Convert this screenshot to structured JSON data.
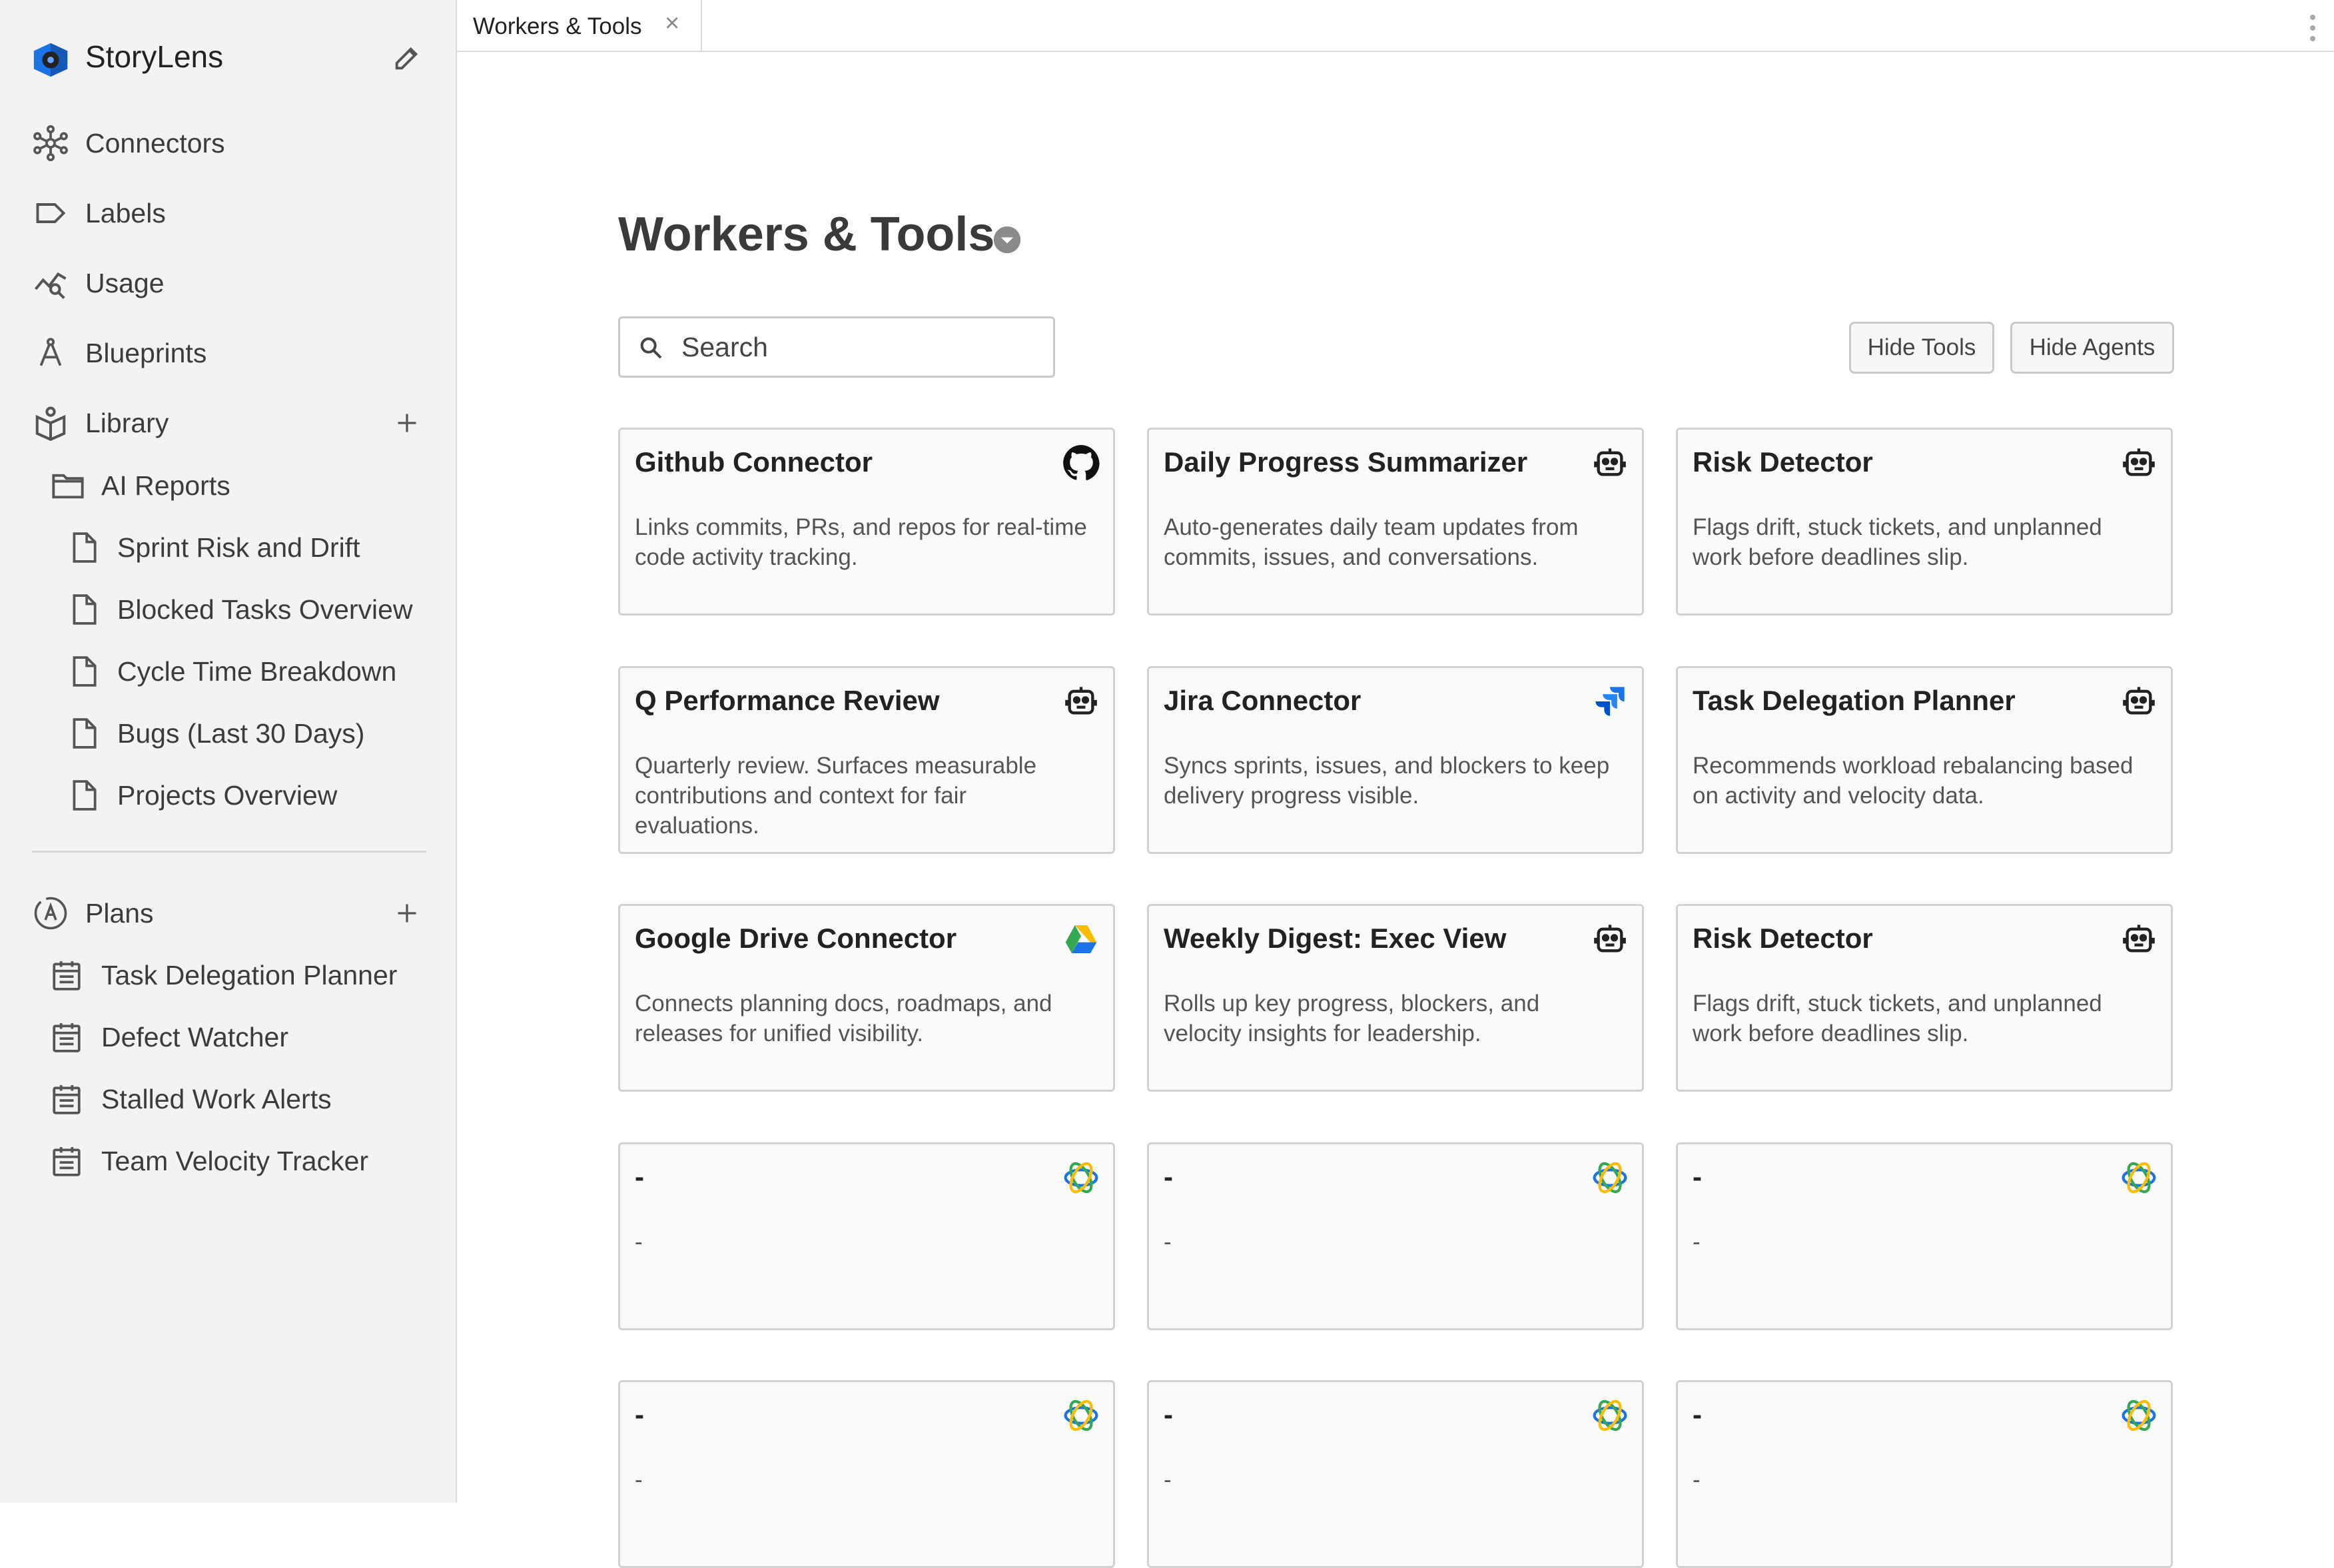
{
  "sidebar": {
    "brand": "StoryLens",
    "nav": [
      {
        "label": "Connectors",
        "icon": "hub-icon"
      },
      {
        "label": "Labels",
        "icon": "label-icon"
      },
      {
        "label": "Usage",
        "icon": "usage-chart-icon"
      },
      {
        "label": "Blueprints",
        "icon": "compass-icon"
      },
      {
        "label": "Library",
        "icon": "library-icon"
      }
    ],
    "library": {
      "folder": "AI Reports",
      "reports": [
        "Sprint Risk and Drift",
        "Blocked Tasks Overview",
        "Cycle Time Breakdown",
        "Bugs (Last 30 Days)",
        "Projects Overview"
      ]
    },
    "plans": {
      "label": "Plans",
      "items": [
        "Task Delegation Planner",
        "Defect Watcher",
        "Stalled Work Alerts",
        "Team Velocity Tracker"
      ]
    }
  },
  "tab": {
    "label": "Workers & Tools",
    "close": "×"
  },
  "main": {
    "title": "Workers & Tools",
    "search_placeholder": "Search",
    "hide_tools": "Hide Tools",
    "hide_agents": "Hide Agents",
    "cards": [
      {
        "title": "Github Connector",
        "desc": "Links commits, PRs, and repos for real-time code activity tracking.",
        "icon": "github-icon"
      },
      {
        "title": "Daily Progress Summarizer",
        "desc": "Auto-generates daily team updates from commits, issues, and conversations.",
        "icon": "robot-icon"
      },
      {
        "title": "Risk Detector",
        "desc": "Flags drift, stuck tickets, and unplanned work before deadlines slip.",
        "icon": "robot-icon"
      },
      {
        "title": "Q Performance Review",
        "desc": "Quarterly review. Surfaces measurable contributions and context for fair evaluations.",
        "icon": "robot-icon"
      },
      {
        "title": "Jira Connector",
        "desc": "Syncs sprints, issues, and blockers to keep delivery progress visible.",
        "icon": "jira-icon"
      },
      {
        "title": "Task Delegation Planner",
        "desc": "Recommends workload rebalancing based on activity and velocity data.",
        "icon": "robot-icon"
      },
      {
        "title": "Google Drive Connector",
        "desc": "Connects planning docs, roadmaps, and releases for unified visibility.",
        "icon": "google-drive-icon"
      },
      {
        "title": "Weekly Digest: Exec View",
        "desc": "Rolls up key progress, blockers, and velocity insights for leadership.",
        "icon": "robot-icon"
      },
      {
        "title": "Risk Detector",
        "desc": "Flags drift, stuck tickets, and unplanned work before deadlines slip.",
        "icon": "robot-icon"
      },
      {
        "title": "-",
        "desc": "-",
        "icon": "orbit-icon"
      },
      {
        "title": "-",
        "desc": "-",
        "icon": "orbit-icon"
      },
      {
        "title": "-",
        "desc": "-",
        "icon": "orbit-icon"
      },
      {
        "title": "-",
        "desc": "-",
        "icon": "orbit-icon"
      },
      {
        "title": "-",
        "desc": "-",
        "icon": "orbit-icon"
      },
      {
        "title": "-",
        "desc": "-",
        "icon": "orbit-icon"
      }
    ]
  },
  "colors": {
    "brand_blue": "#1a73e8",
    "sidebar_bg": "#f3f3f3",
    "border": "#d2d2d2"
  }
}
